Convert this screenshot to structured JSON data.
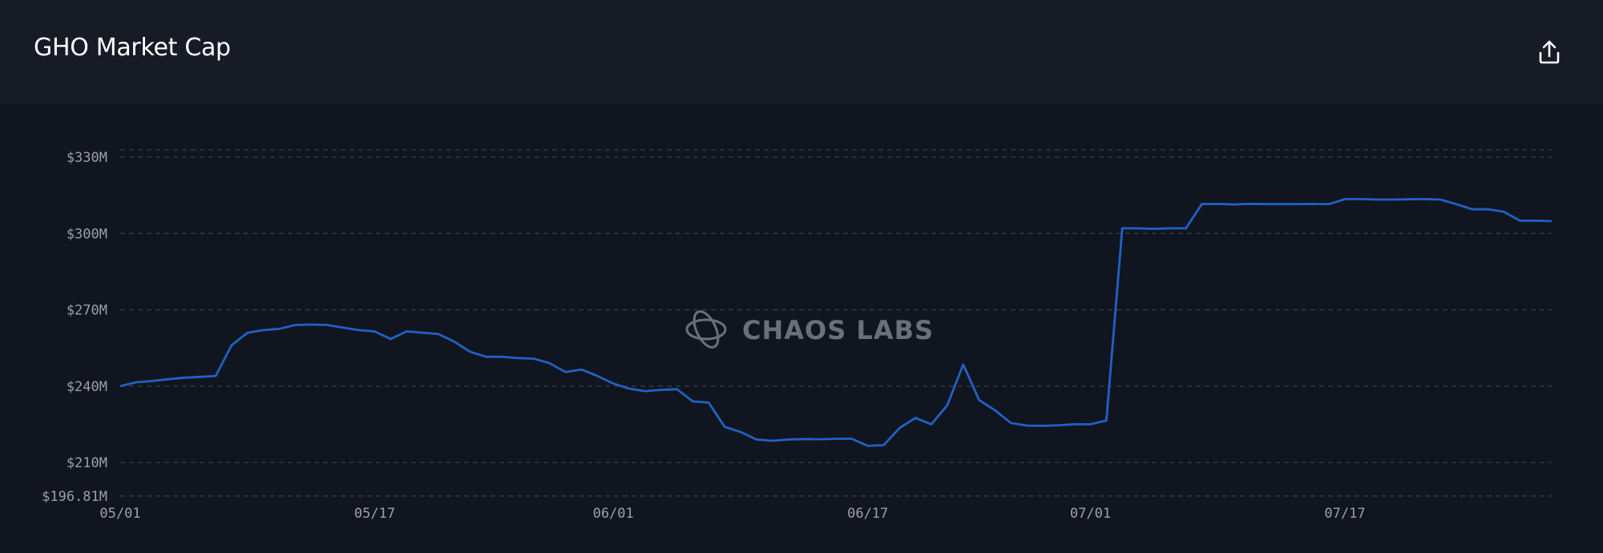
{
  "card": {
    "title": "GHO Market Cap",
    "export_icon": "share-upload-icon"
  },
  "watermark": {
    "text": "CHAOS LABS",
    "icon": "chaos-labs-logo-icon"
  },
  "colors": {
    "line": "#1f62c4",
    "grid": "#3a3f4b",
    "tick_text": "#9aa0ab",
    "background": "#111520",
    "header": "#161b26"
  },
  "chart_data": {
    "type": "line",
    "title": "GHO Market Cap",
    "xlabel": "",
    "ylabel": "",
    "ylim": [
      196.81,
      334
    ],
    "y_unit": "M USD",
    "y_ticks": [
      {
        "value": 196.81,
        "label": "$196.81M"
      },
      {
        "value": 210,
        "label": "$210M"
      },
      {
        "value": 240,
        "label": "$240M"
      },
      {
        "value": 270,
        "label": "$270M"
      },
      {
        "value": 300,
        "label": "$300M"
      },
      {
        "value": 330,
        "label": "$330M"
      }
    ],
    "x_ticks": [
      {
        "day": 0,
        "label": "05/01"
      },
      {
        "day": 16,
        "label": "05/17"
      },
      {
        "day": 31,
        "label": "06/01"
      },
      {
        "day": 47,
        "label": "06/17"
      },
      {
        "day": 61,
        "label": "07/01"
      },
      {
        "day": 77,
        "label": "07/17"
      }
    ],
    "grid": true,
    "series": [
      {
        "values": [
          [
            0,
            240.0
          ],
          [
            1,
            241.5
          ],
          [
            2,
            242.0
          ],
          [
            3,
            242.7
          ],
          [
            4,
            243.3
          ],
          [
            5,
            243.6
          ],
          [
            6,
            244.0
          ],
          [
            7,
            256.0
          ],
          [
            8,
            261.0
          ],
          [
            9,
            262.0
          ],
          [
            10,
            262.5
          ],
          [
            11,
            264.0
          ],
          [
            12,
            264.2
          ],
          [
            13,
            264.0
          ],
          [
            14,
            263.0
          ],
          [
            15,
            262.0
          ],
          [
            16,
            261.5
          ],
          [
            17,
            258.5
          ],
          [
            18,
            261.5
          ],
          [
            19,
            261.0
          ],
          [
            20,
            260.5
          ],
          [
            21,
            257.5
          ],
          [
            22,
            253.5
          ],
          [
            23,
            251.5
          ],
          [
            24,
            251.5
          ],
          [
            25,
            251.0
          ],
          [
            26,
            250.8
          ],
          [
            27,
            249.0
          ],
          [
            28,
            245.5
          ],
          [
            29,
            246.5
          ],
          [
            30,
            244.0
          ],
          [
            31,
            241.0
          ],
          [
            32,
            239.0
          ],
          [
            33,
            238.0
          ],
          [
            34,
            238.5
          ],
          [
            35,
            238.8
          ],
          [
            36,
            234.0
          ],
          [
            37,
            233.5
          ],
          [
            38,
            224.0
          ],
          [
            39,
            222.0
          ],
          [
            40,
            219.0
          ],
          [
            41,
            218.5
          ],
          [
            42,
            219.0
          ],
          [
            43,
            219.2
          ],
          [
            44,
            219.1
          ],
          [
            45,
            219.3
          ],
          [
            46,
            219.3
          ],
          [
            47,
            216.5
          ],
          [
            48,
            216.8
          ],
          [
            49,
            223.5
          ],
          [
            50,
            227.5
          ],
          [
            51,
            225.0
          ],
          [
            52,
            232.5
          ],
          [
            53,
            248.5
          ],
          [
            54,
            234.5
          ],
          [
            55,
            230.5
          ],
          [
            56,
            225.5
          ],
          [
            57,
            224.5
          ],
          [
            58,
            224.4
          ],
          [
            59,
            224.6
          ],
          [
            60,
            225.0
          ],
          [
            61,
            225.0
          ],
          [
            62,
            226.5
          ],
          [
            63,
            302.0
          ],
          [
            64,
            302.0
          ],
          [
            65,
            301.8
          ],
          [
            66,
            302.0
          ],
          [
            67,
            302.0
          ],
          [
            68,
            311.5
          ],
          [
            69,
            311.6
          ],
          [
            70,
            311.4
          ],
          [
            71,
            311.6
          ],
          [
            72,
            311.5
          ],
          [
            73,
            311.5
          ],
          [
            74,
            311.5
          ],
          [
            75,
            311.6
          ],
          [
            76,
            311.5
          ],
          [
            77,
            313.5
          ],
          [
            78,
            313.5
          ],
          [
            79,
            313.3
          ],
          [
            80,
            313.3
          ],
          [
            81,
            313.4
          ],
          [
            82,
            313.5
          ],
          [
            83,
            313.3
          ],
          [
            84,
            311.5
          ],
          [
            85,
            309.5
          ],
          [
            86,
            309.5
          ],
          [
            87,
            308.5
          ],
          [
            88,
            305.0
          ],
          [
            89,
            305.0
          ],
          [
            90,
            304.8
          ]
        ]
      }
    ]
  }
}
